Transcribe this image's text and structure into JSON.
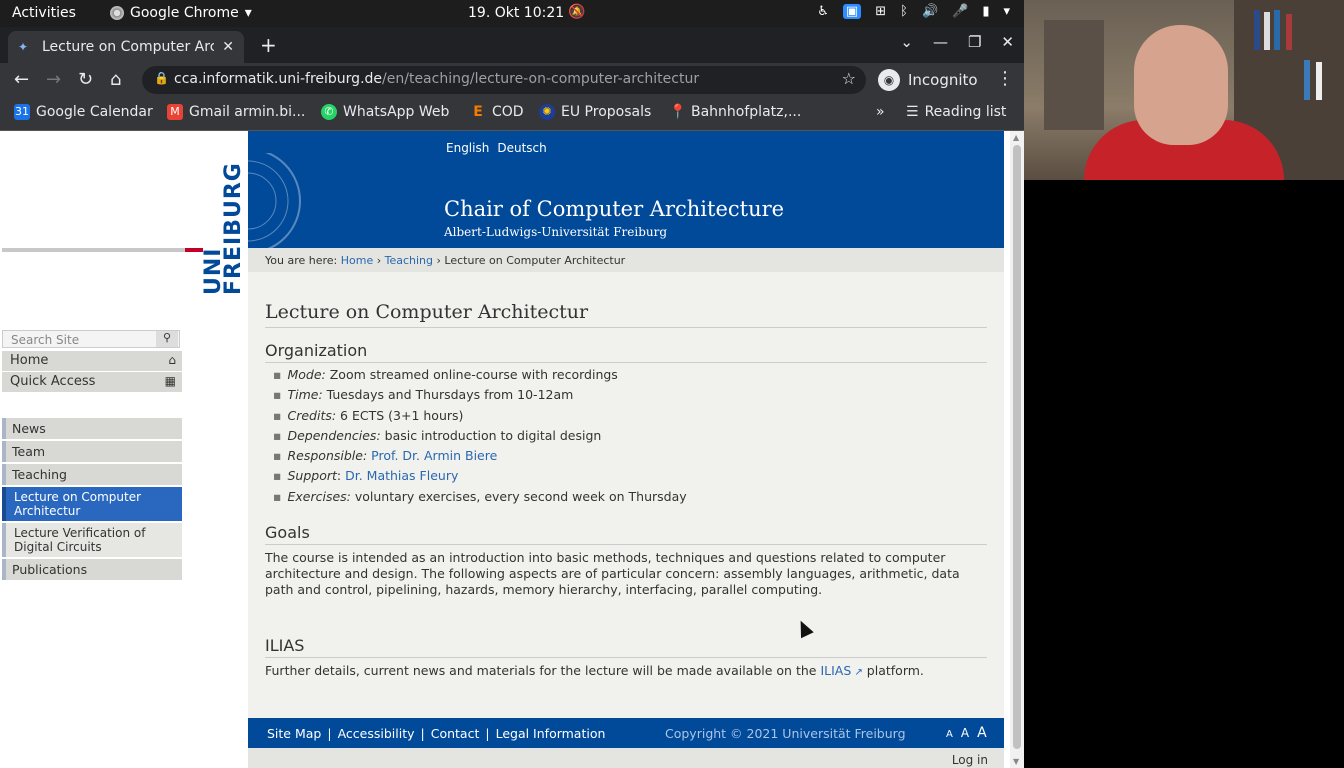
{
  "system": {
    "activities": "Activities",
    "app": "Google Chrome",
    "clock": "19. Okt  10:21"
  },
  "browser": {
    "tab_title": "Lecture on Computer Arc",
    "url_host": "cca.informatik.uni-freiburg.de",
    "url_path": "/en/teaching/lecture-on-computer-architectur",
    "incognito_label": "Incognito",
    "bookmarks": [
      {
        "label": "Google Calendar",
        "color": "#1a73e8"
      },
      {
        "label": "Gmail armin.bi...",
        "color": "#ea4335"
      },
      {
        "label": "WhatsApp Web",
        "color": "#25d366"
      },
      {
        "label": "COD",
        "color": "#f57c00"
      },
      {
        "label": "EU Proposals",
        "color": "#1a3e9a"
      },
      {
        "label": "Bahnhofplatz,...",
        "color": "#34a853"
      }
    ],
    "reading_list": "Reading list"
  },
  "site": {
    "lang": [
      "English",
      "Deutsch"
    ],
    "logo_line1": "UNI",
    "logo_line2": "FREIBURG",
    "title": "Chair of Computer Architecture",
    "subtitle": "Albert-Ludwigs-Universität Freiburg",
    "breadcrumb": {
      "prefix": "You are here: ",
      "items": [
        "Home",
        "Teaching"
      ],
      "current": "Lecture on Computer Architectur"
    },
    "search_placeholder": "Search Site",
    "home": "Home",
    "quick_access": "Quick Access",
    "menu": [
      "News",
      "Team",
      "Teaching",
      "Lecture on Computer Architectur",
      "Lecture Verification of Digital Circuits",
      "Publications"
    ]
  },
  "content": {
    "page_title": "Lecture on Computer Architectur",
    "organization_heading": "Organization",
    "items": [
      {
        "label": "Mode:",
        "text": " Zoom streamed online-course with recordings"
      },
      {
        "label": "Time:",
        "text": " Tuesdays and Thursdays from 10-12am"
      },
      {
        "label": "Credits:",
        "text": " 6 ECTS (3+1 hours)"
      },
      {
        "label": "Dependencies:",
        "text": " basic introduction to digital design"
      },
      {
        "label": "Responsible:",
        "link": "Prof. Dr. Armin Biere"
      },
      {
        "label": "Support",
        "link": "Dr. Mathias Fleury"
      },
      {
        "label": "Exercises:",
        "text": " voluntary exercises, every second week on Thursday"
      }
    ],
    "goals_heading": "Goals",
    "goals_text": "The course is intended as an introduction into basic methods, techniques and questions related to computer architecture and design. The following aspects are of particular concern:  assembly languages, arithmetic, data path and control, pipelining, hazards, memory hierarchy, interfacing, parallel computing.",
    "ilias_heading": "ILIAS",
    "ilias_pre": "Further details, current news and materials for the lecture will be made available on the ",
    "ilias_link": "ILIAS",
    "ilias_post": " platform."
  },
  "footer": {
    "links": [
      "Site Map",
      "Accessibility",
      "Contact",
      "Legal Information"
    ],
    "separator": "|",
    "copyright": "Copyright © 2021 Universität Freiburg",
    "font_sizes": [
      "A",
      "A",
      "A"
    ],
    "login": "Log in"
  }
}
